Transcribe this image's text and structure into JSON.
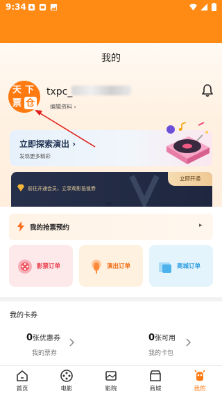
{
  "status_bar": {
    "time": "9:34"
  },
  "page": {
    "title": "我的"
  },
  "profile": {
    "avatar_chars": [
      "天",
      "下",
      "票",
      "仓"
    ],
    "username": "txpc_",
    "edit_profile": "编辑资料 ›"
  },
  "explore": {
    "title": "立即探索演出 ›",
    "subtitle": "发现更多精彩"
  },
  "membership": {
    "text": "前往开通会员，立享观影抵值券",
    "button": "立即开通"
  },
  "booking": {
    "label": "我的抢票预约",
    "arrow": "▸"
  },
  "orders": [
    {
      "label": "影票订单"
    },
    {
      "label": "演出订单"
    },
    {
      "label": "商城订单"
    }
  ],
  "cards": {
    "title": "我的卡券",
    "coupons": {
      "count": "0",
      "unit": "张优惠券",
      "label": "我的票券"
    },
    "cardbag": {
      "count": "0",
      "unit": "张可用",
      "label": "我的卡包"
    }
  },
  "tabs": [
    {
      "label": "首页"
    },
    {
      "label": "电影"
    },
    {
      "label": "影院"
    },
    {
      "label": "商城"
    },
    {
      "label": "我的"
    }
  ],
  "colors": {
    "accent": "#ff8a14",
    "active_tab": "#ff7a10"
  }
}
